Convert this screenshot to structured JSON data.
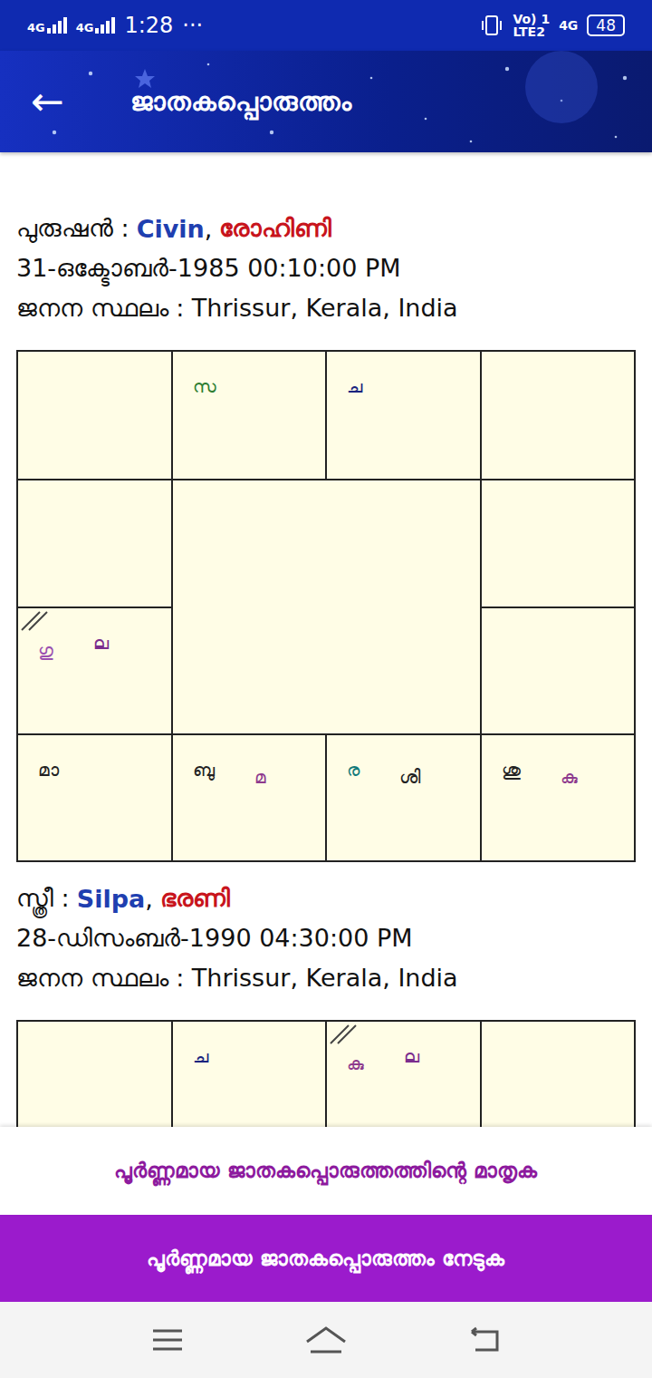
{
  "status_bar": {
    "signal1": "4G",
    "signal2": "4G",
    "time": "1:28",
    "more": "···",
    "volte": "Vo) 1",
    "lte": "LTE2",
    "net": "4G",
    "battery": "48"
  },
  "header": {
    "back": "←",
    "title": "ജാതകപ്പൊരുത്തം"
  },
  "persons": [
    {
      "label": "പുരുഷൻ :",
      "name": "Civin",
      "sep": ",",
      "star": "രോഹിണി",
      "dob": "31-ഒക്ടോബർ-1985 00:10:00 PM",
      "place": "ജനന സ്ഥലം : Thrissur, Kerala, India",
      "chart": {
        "cells": [
          {
            "lagna": false,
            "planets": []
          },
          {
            "lagna": false,
            "planets": [
              {
                "text": "സ",
                "color": "#2e7d32"
              }
            ]
          },
          {
            "lagna": false,
            "planets": [
              {
                "text": "ച",
                "color": "#1a237e"
              }
            ]
          },
          {
            "lagna": false,
            "planets": []
          },
          {
            "lagna": false,
            "planets": []
          },
          {
            "lagna": false,
            "planets": []
          },
          {
            "lagna": true,
            "planets": [
              {
                "text": "ഗു",
                "color": "#9a4fb0"
              },
              {
                "text": "ല",
                "color": "#7b2d8e"
              }
            ]
          },
          {
            "lagna": false,
            "planets": []
          },
          {
            "lagna": false,
            "planets": [
              {
                "text": "മാ",
                "color": "#222222"
              }
            ]
          },
          {
            "lagna": false,
            "planets": [
              {
                "text": "ബു",
                "color": "#222222"
              },
              {
                "text": "മ",
                "color": "#8e3a8e"
              }
            ]
          },
          {
            "lagna": false,
            "planets": [
              {
                "text": "ര",
                "color": "#127a7a"
              },
              {
                "text": "ശി",
                "color": "#222222"
              }
            ]
          },
          {
            "lagna": false,
            "planets": [
              {
                "text": "ശു",
                "color": "#222222"
              },
              {
                "text": "കു",
                "color": "#8e3a8e"
              }
            ]
          }
        ]
      }
    },
    {
      "label": "സ്ത്രീ :",
      "name": "Silpa",
      "sep": ",",
      "star": "ഭരണി",
      "dob": "28-ഡിസംബർ-1990 04:30:00 PM",
      "place": "ജനന സ്ഥലം : Thrissur, Kerala, India",
      "chart": {
        "cells": [
          {
            "lagna": false,
            "planets": []
          },
          {
            "lagna": false,
            "planets": [
              {
                "text": "ച",
                "color": "#1a237e"
              }
            ]
          },
          {
            "lagna": true,
            "planets": [
              {
                "text": "കു",
                "color": "#8e3a8e"
              },
              {
                "text": "ല",
                "color": "#7b2d8e"
              }
            ]
          },
          {
            "lagna": false,
            "planets": []
          }
        ]
      }
    }
  ],
  "sample_link": "പൂർണ്ണമായ ജാതകപ്പൊരുത്തത്തിന്റെ മാതൃക",
  "get_button": "പൂർണ്ണമായ ജാതകപ്പൊരുത്തം നേടുക"
}
